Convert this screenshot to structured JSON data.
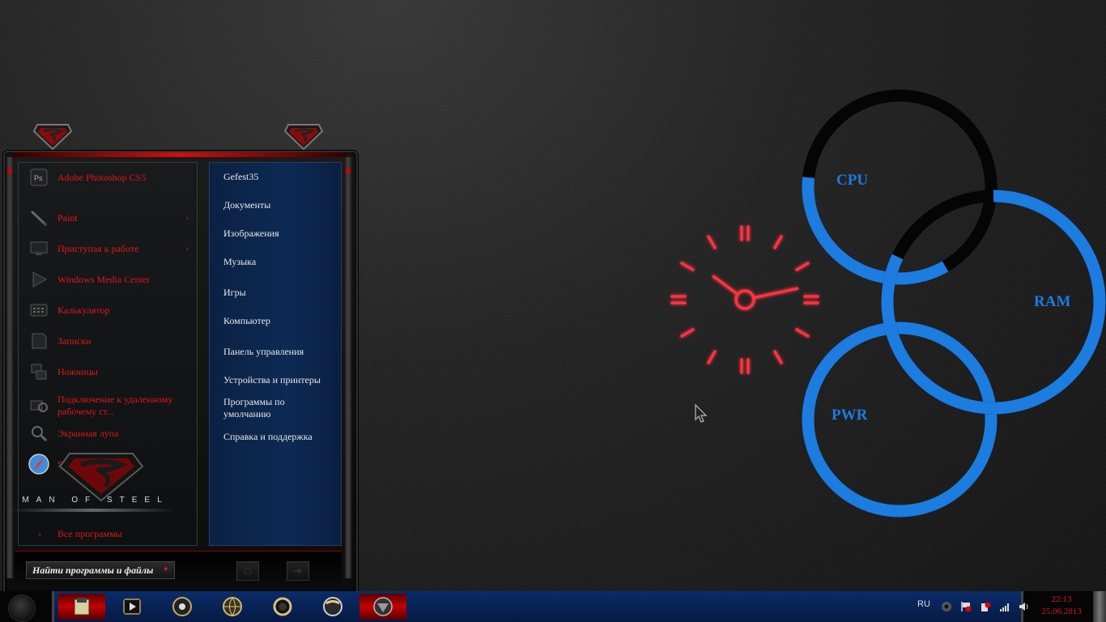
{
  "start_menu": {
    "programs": [
      {
        "label": "Adobe Photoshop CS5",
        "icon": "photoshop-icon",
        "has_submenu": false
      },
      {
        "label": "Paint",
        "icon": "paint-brush-icon",
        "has_submenu": true
      },
      {
        "label": "Приступая к работе",
        "icon": "monitor-icon",
        "has_submenu": true
      },
      {
        "label": "Windows Media Center",
        "icon": "play-icon",
        "has_submenu": false
      },
      {
        "label": "Калькулятор",
        "icon": "calculator-icon",
        "has_submenu": false
      },
      {
        "label": "Записки",
        "icon": "note-icon",
        "has_submenu": false
      },
      {
        "label": "Ножницы",
        "icon": "scissors-icon",
        "has_submenu": false
      },
      {
        "label": "Подключение к удаленному рабочему ст...",
        "icon": "remote-desktop-icon",
        "has_submenu": false
      },
      {
        "label": "Экранная лупа",
        "icon": "magnifier-icon",
        "has_submenu": false
      },
      {
        "label": "Safari",
        "icon": "safari-icon",
        "has_submenu": false
      }
    ],
    "submenu_arrow": "›",
    "caption": "MAN OF STEEL",
    "all_programs": {
      "arrow": "›",
      "label": "Все программы"
    },
    "places": [
      "Gefest35",
      "Документы",
      "Изображения",
      "Музыка",
      "Игры",
      "Компьютер",
      "Панель управления",
      "Устройства и принтеры",
      "Программы по умолчанию",
      "Справка и поддержка"
    ],
    "search": {
      "placeholder": "Найти программы и файлы"
    }
  },
  "clock_gadget": {
    "hour": 10,
    "minute": 13
  },
  "meter_gadget": {
    "cpu": {
      "label": "CPU",
      "level": 0.35
    },
    "ram": {
      "label": "RAM",
      "level": 0.82
    },
    "pwr": {
      "label": "PWR",
      "level": 1.0
    },
    "accent": "#1c7ce0"
  },
  "taskbar": {
    "apps": [
      {
        "name": "explorer",
        "icon": "folder-icon",
        "active": true
      },
      {
        "name": "media-player",
        "icon": "media-player-icon",
        "active": false
      },
      {
        "name": "app-3",
        "icon": "disc-icon",
        "active": false
      },
      {
        "name": "app-4",
        "icon": "globe-icon",
        "active": false
      },
      {
        "name": "app-5",
        "icon": "ring-icon",
        "active": false
      },
      {
        "name": "app-6",
        "icon": "sphere-icon",
        "active": false
      },
      {
        "name": "app-7",
        "icon": "superman-icon",
        "active": true
      }
    ],
    "tray": {
      "language": "RU",
      "time": "22:13",
      "date": "25.06.2013"
    }
  },
  "colors": {
    "accent_red": "#e01818",
    "accent_blue": "#1c7ce0",
    "places_bg": "#0d2a55"
  }
}
